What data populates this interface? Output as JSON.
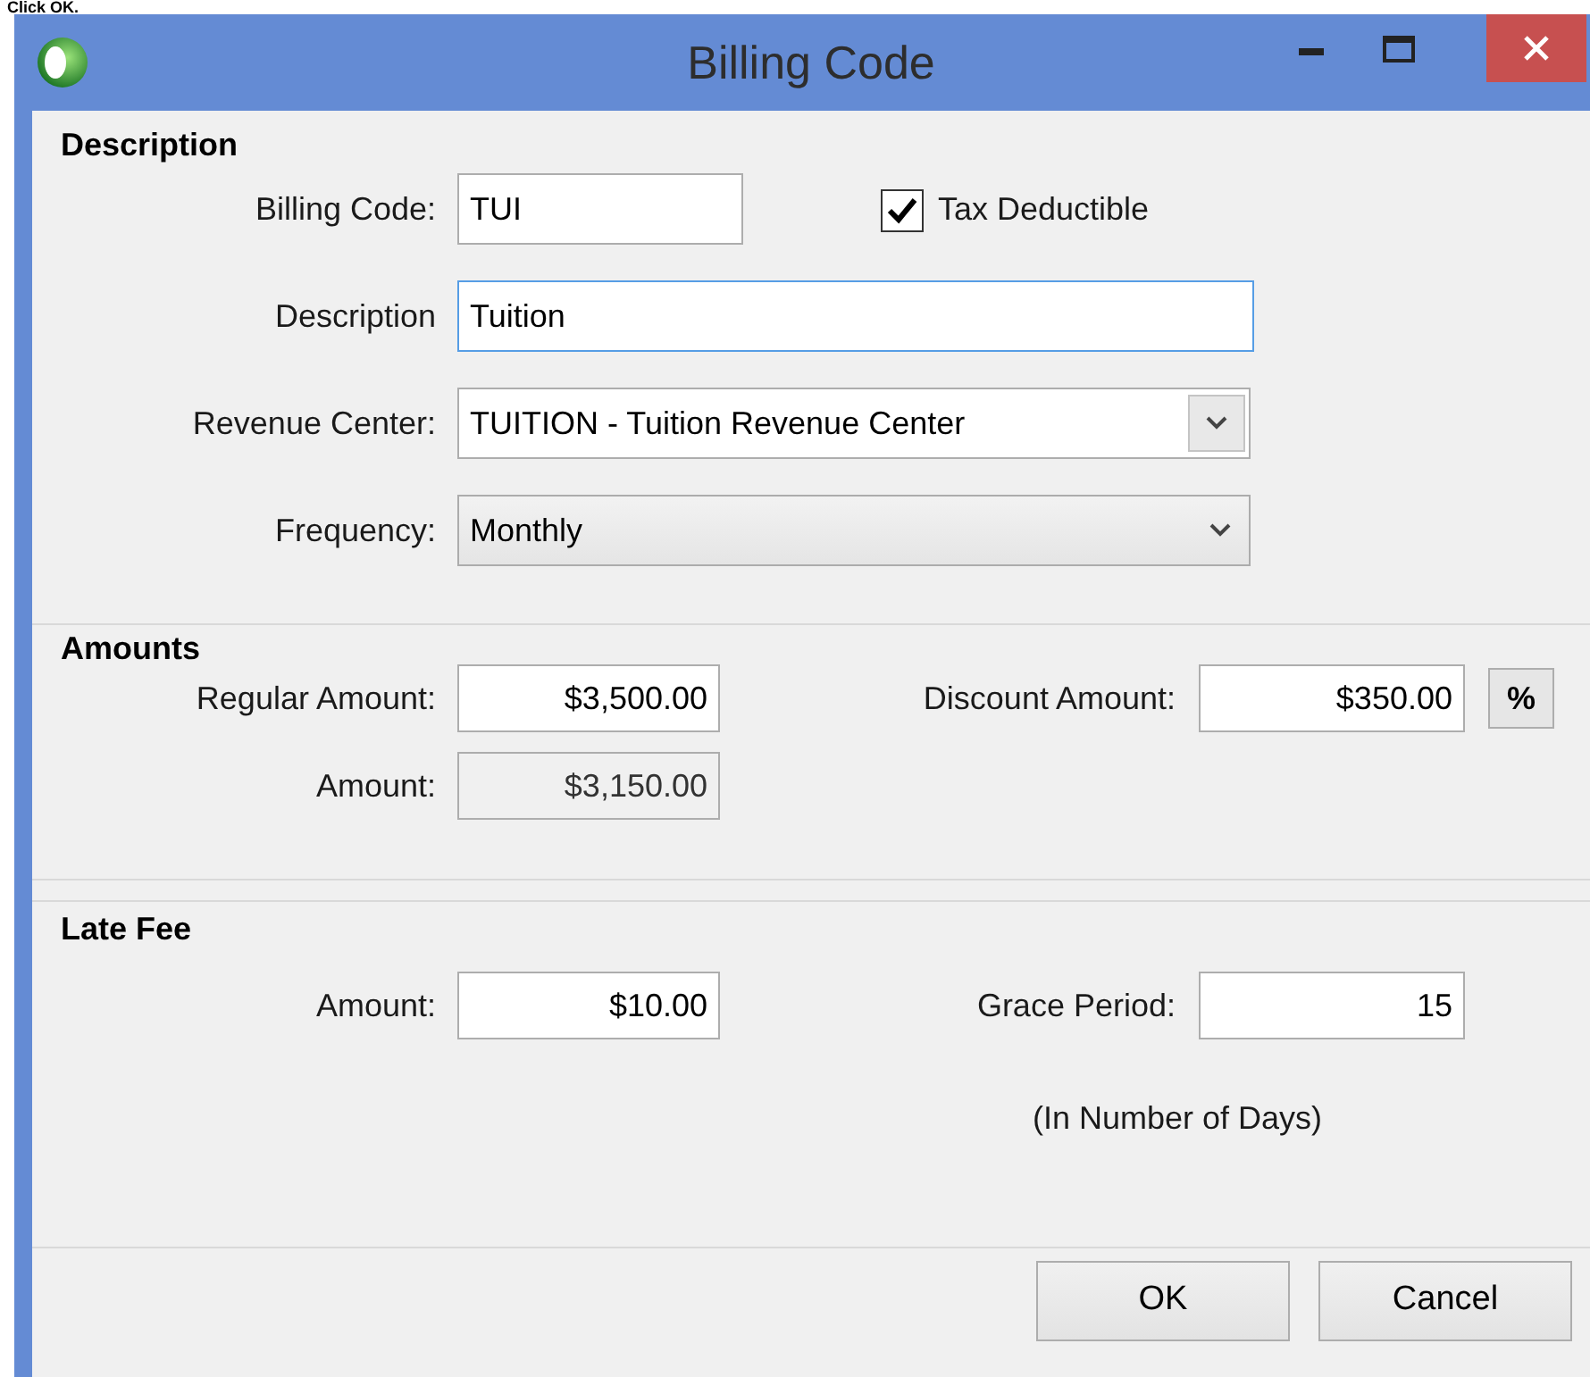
{
  "caption": "Click OK.",
  "window": {
    "title": "Billing Code"
  },
  "description": {
    "title": "Description",
    "billing_code": {
      "label": "Billing Code:",
      "value": "TUI"
    },
    "tax_deductible": {
      "label": "Tax Deductible",
      "checked": true
    },
    "description": {
      "label": "Description",
      "value": "Tuition",
      "focused": true
    },
    "revenue_center": {
      "label": "Revenue Center:",
      "value": "TUITION - Tuition Revenue Center"
    },
    "frequency": {
      "label": "Frequency:",
      "value": "Monthly"
    }
  },
  "amounts": {
    "title": "Amounts",
    "regular_amount": {
      "label": "Regular Amount:",
      "value": "$3,500.00"
    },
    "discount_amount": {
      "label": "Discount Amount:",
      "value": "$350.00"
    },
    "percent_button": "%",
    "amount": {
      "label": "Amount:",
      "value": "$3,150.00",
      "disabled": true
    }
  },
  "late_fee": {
    "title": "Late Fee",
    "amount": {
      "label": "Amount:",
      "value": "$10.00"
    },
    "grace_period": {
      "label": "Grace Period:",
      "value": "15"
    },
    "note": "(In Number of Days)"
  },
  "buttons": [
    {
      "label": "OK"
    },
    {
      "label": "Cancel"
    }
  ]
}
